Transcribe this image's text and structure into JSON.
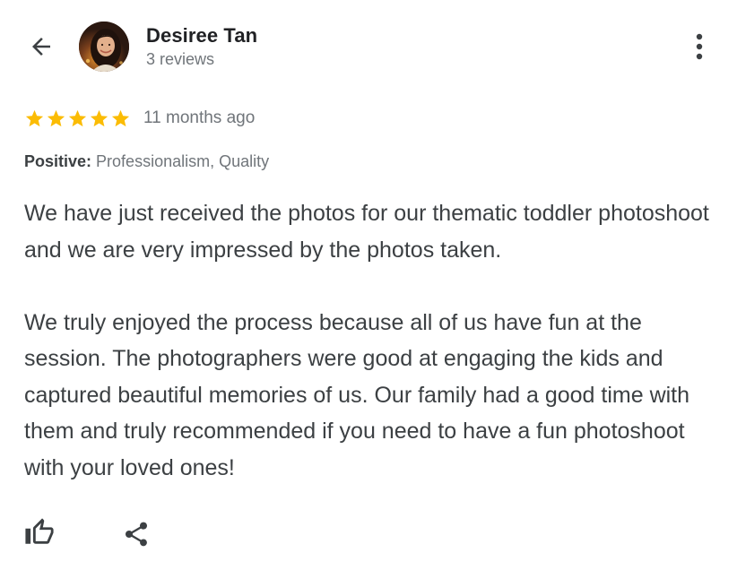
{
  "header": {
    "back_icon": "arrow-back-icon",
    "reviewer_name": "Desiree Tan",
    "review_count": "3 reviews",
    "more_icon": "more-vert-icon"
  },
  "review": {
    "rating": 5,
    "rating_max": 5,
    "star_color": "#fbbc04",
    "time_ago": "11 months ago",
    "positive_label": "Positive:",
    "positive_value": "Professionalism, Quality",
    "paragraphs": [
      "We have just received the photos for our thematic toddler photoshoot and we are very impressed by the photos taken.",
      "We truly enjoyed the process because all of us have fun at the session. The photographers were good at engaging the kids and captured beautiful memories of us. Our family had a good time with them and truly recommended if you need to have a fun photoshoot with your loved ones!"
    ]
  },
  "actions": {
    "like_icon": "thumbs-up-icon",
    "share_icon": "share-icon"
  }
}
